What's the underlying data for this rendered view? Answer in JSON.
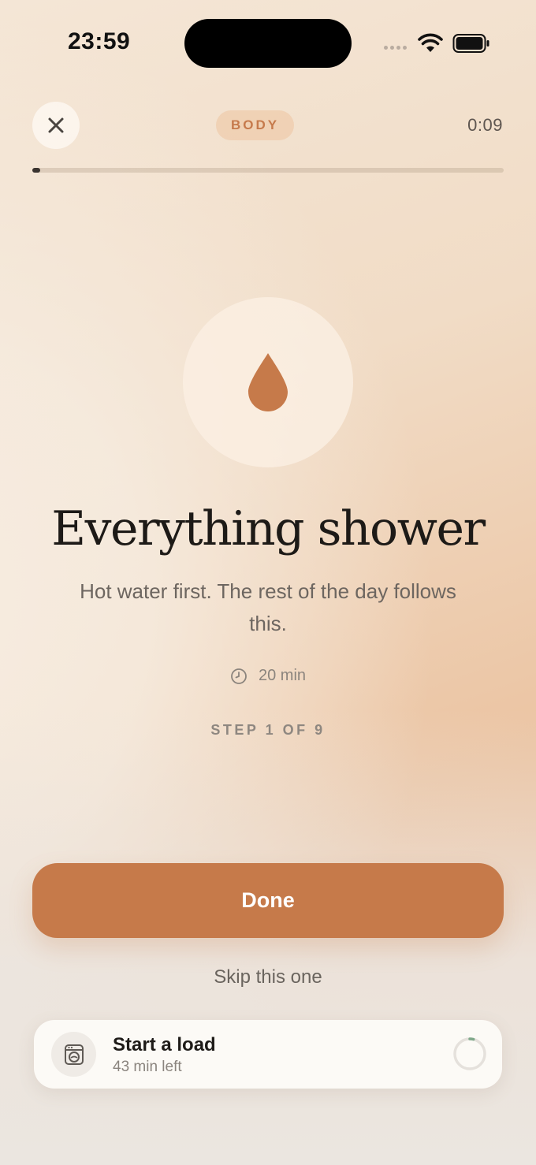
{
  "status_bar": {
    "time": "23:59",
    "icons": [
      "cellular-signal-icon",
      "wifi-icon",
      "battery-icon"
    ]
  },
  "header": {
    "close_icon": "close-icon",
    "category": "BODY",
    "elapsed": "0:09",
    "progress_fraction": 0.015
  },
  "step": {
    "icon": "water-drop-icon",
    "title": "Everything shower",
    "description": "Hot water first. The rest of the day follows this.",
    "duration_icon": "clock-icon",
    "duration": "20 min",
    "counter": "STEP 1 OF 9"
  },
  "actions": {
    "done_label": "Done",
    "skip_label": "Skip this one"
  },
  "background_task": {
    "icon": "washing-machine-icon",
    "title": "Start a load",
    "subtitle": "43 min left",
    "progress_fraction": 0.04
  },
  "colors": {
    "accent": "#c67a4a",
    "pill_text": "#c67a4c",
    "ring_progress": "#7fa88a"
  }
}
